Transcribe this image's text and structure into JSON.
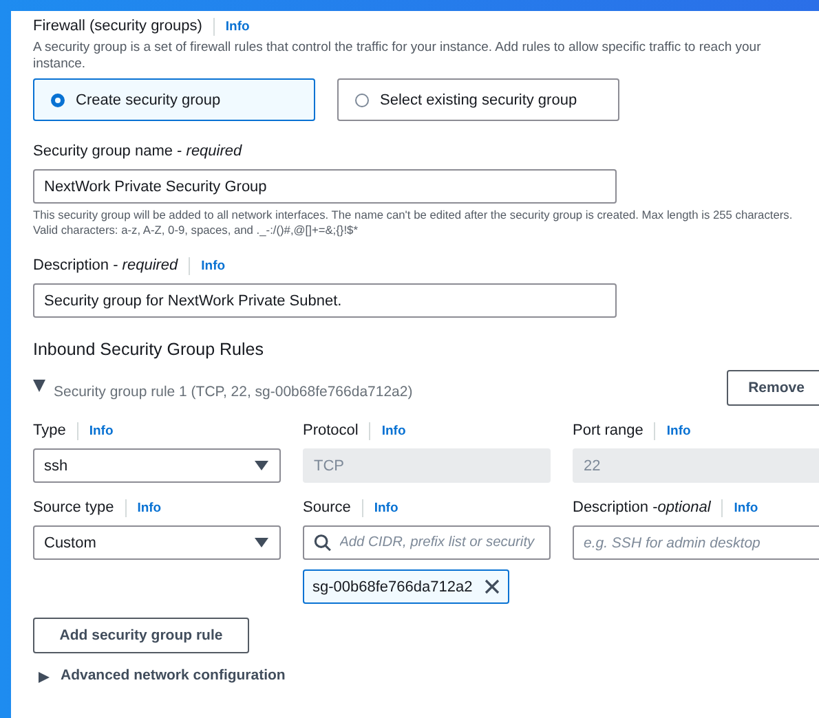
{
  "firewall": {
    "title": "Firewall (security groups)",
    "info": "Info",
    "description": "A security group is a set of firewall rules that control the traffic for your instance. Add rules to allow specific traffic to reach your instance.",
    "options": [
      {
        "label": "Create security group",
        "selected": true
      },
      {
        "label": "Select existing security group",
        "selected": false
      }
    ],
    "name_field": {
      "label": "Security group name -",
      "qualifier": "required",
      "value": "NextWork Private Security Group"
    },
    "name_hint": "This security group will be added to all network interfaces. The name can't be edited after the security group is created. Max length is 255 characters. Valid characters: a-z, A-Z, 0-9, spaces, and ._-:/()#,@[]+=&;{}!$*",
    "description_field": {
      "label": "Description -",
      "qualifier": "required",
      "info": "Info",
      "value": "Security group for NextWork Private Subnet."
    }
  },
  "inbound": {
    "title": "Inbound Security Group Rules",
    "rule": {
      "summary": "Security group rule 1 (TCP, 22, sg-00b68fe766da712a2)",
      "expanded": true,
      "remove": "Remove"
    },
    "fields": [
      {
        "kind": "select",
        "label": "Type",
        "info": "Info",
        "value": "ssh"
      },
      {
        "kind": "readonly",
        "label": "Protocol",
        "info": "Info",
        "value": "TCP"
      },
      {
        "kind": "readonly",
        "label": "Port range",
        "info": "Info",
        "value": "22"
      },
      {
        "kind": "select",
        "label": "Source type",
        "info": "Info",
        "value": "Custom"
      },
      {
        "kind": "search",
        "label": "Source",
        "info": "Info",
        "placeholder": "Add CIDR, prefix list or security",
        "token": "sg-00b68fe766da712a2"
      },
      {
        "kind": "text",
        "label": "Description -",
        "qualifier": "optional",
        "info": "Info",
        "placeholder": "e.g. SSH for admin desktop"
      }
    ],
    "add_button": "Add security group rule"
  },
  "advanced": {
    "label": "Advanced network configuration",
    "expanded": false
  }
}
